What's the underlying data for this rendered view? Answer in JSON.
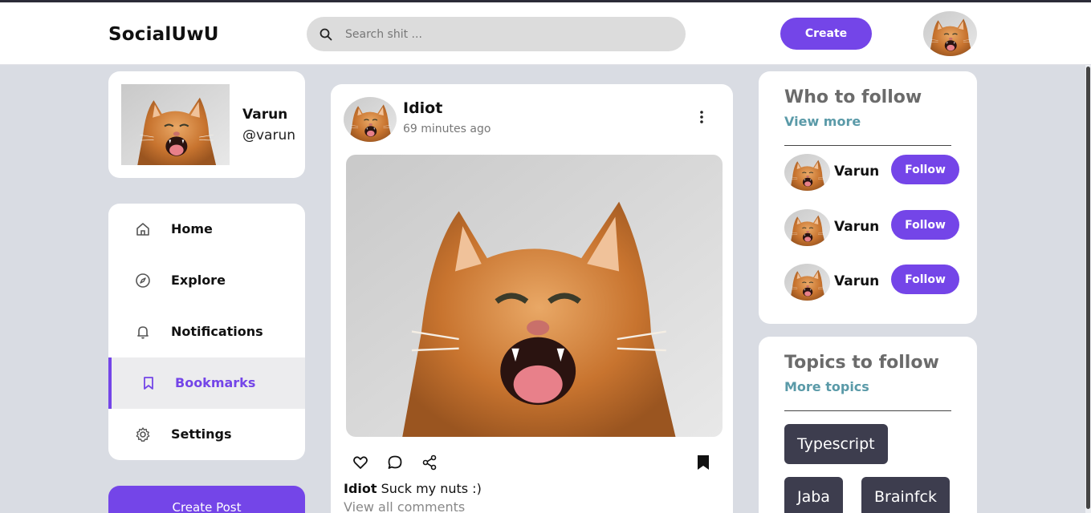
{
  "app": {
    "logo": "SocialUwU"
  },
  "search": {
    "placeholder": "Search shit ..."
  },
  "header": {
    "create_label": "Create"
  },
  "profile": {
    "name": "Varun",
    "handle": "@varun"
  },
  "menu": {
    "items": [
      {
        "label": "Home",
        "icon": "home-icon"
      },
      {
        "label": "Explore",
        "icon": "compass-icon"
      },
      {
        "label": "Notifications",
        "icon": "bell-icon"
      },
      {
        "label": "Bookmarks",
        "icon": "bookmark-icon",
        "active": true
      },
      {
        "label": "Settings",
        "icon": "gear-icon"
      }
    ],
    "create_post_label": "Create Post"
  },
  "post": {
    "author": "Idiot",
    "time": "69 minutes ago",
    "caption_author": "Idiot",
    "caption_text": " Suck my nuts :)",
    "comments_link": "View all comments"
  },
  "who_to_follow": {
    "title": "Who to follow",
    "link": "View more",
    "people": [
      {
        "name": "Varun",
        "button": "Follow"
      },
      {
        "name": "Varun",
        "button": "Follow"
      },
      {
        "name": "Varun",
        "button": "Follow"
      }
    ]
  },
  "topics": {
    "title": "Topics to follow",
    "link": "More topics",
    "items": [
      "Typescript",
      "Jaba",
      "Brainfck"
    ]
  },
  "colors": {
    "accent": "#7445e8",
    "link": "#5a9aa8",
    "chip": "#3d3d4e",
    "background": "#d9dce3"
  }
}
